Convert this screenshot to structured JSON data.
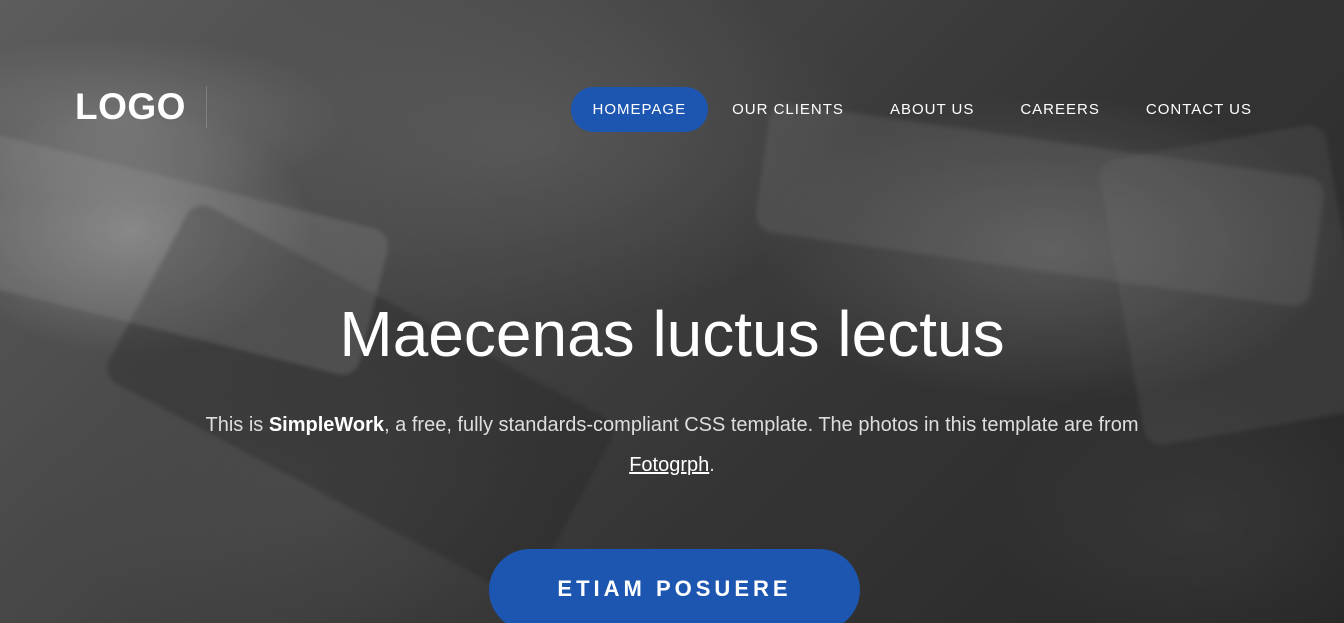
{
  "header": {
    "logo": "LOGO",
    "nav": [
      {
        "label": "HOMEPAGE",
        "active": true
      },
      {
        "label": "OUR CLIENTS",
        "active": false
      },
      {
        "label": "ABOUT US",
        "active": false
      },
      {
        "label": "CAREERS",
        "active": false
      },
      {
        "label": "CONTACT US",
        "active": false
      }
    ]
  },
  "hero": {
    "title": "Maecenas luctus lectus",
    "intro_prefix": "This is ",
    "intro_brand": "SimpleWork",
    "intro_middle": ", a free, fully standards-compliant CSS template. The photos in this template are from ",
    "intro_link": "Fotogrph",
    "intro_suffix": ".",
    "cta_label": "ETIAM POSUERE"
  },
  "colors": {
    "accent": "#1c56b0",
    "text": "#ffffff",
    "muted_text": "#dedede"
  }
}
